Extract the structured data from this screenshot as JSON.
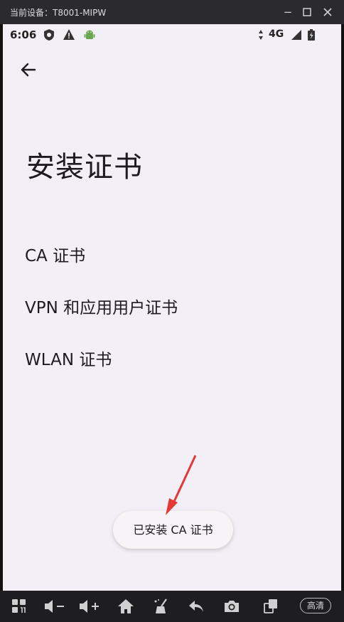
{
  "window": {
    "title": "当前设备：T8001-MIPW",
    "controls": {
      "minimize": "−",
      "maximize": "☐",
      "close": "✕"
    }
  },
  "statusbar": {
    "time": "6:06",
    "network": "4G"
  },
  "page": {
    "title": "安装证书",
    "items": [
      {
        "label": "CA 证书"
      },
      {
        "label": "VPN 和应用用户证书"
      },
      {
        "label": "WLAN 证书"
      }
    ],
    "toast": "已安装 CA 证书"
  },
  "bottombar": {
    "icons": [
      "apps-icon",
      "volume-down-icon",
      "volume-up-icon",
      "home-icon",
      "clean-icon",
      "back-icon",
      "camera-icon",
      "rotate-icon"
    ],
    "quality": "高清"
  },
  "colors": {
    "phone_bg": "#f3eff6",
    "text": "#1d1b20",
    "arrow": "#e53935",
    "chrome": "#2b2b2f"
  }
}
